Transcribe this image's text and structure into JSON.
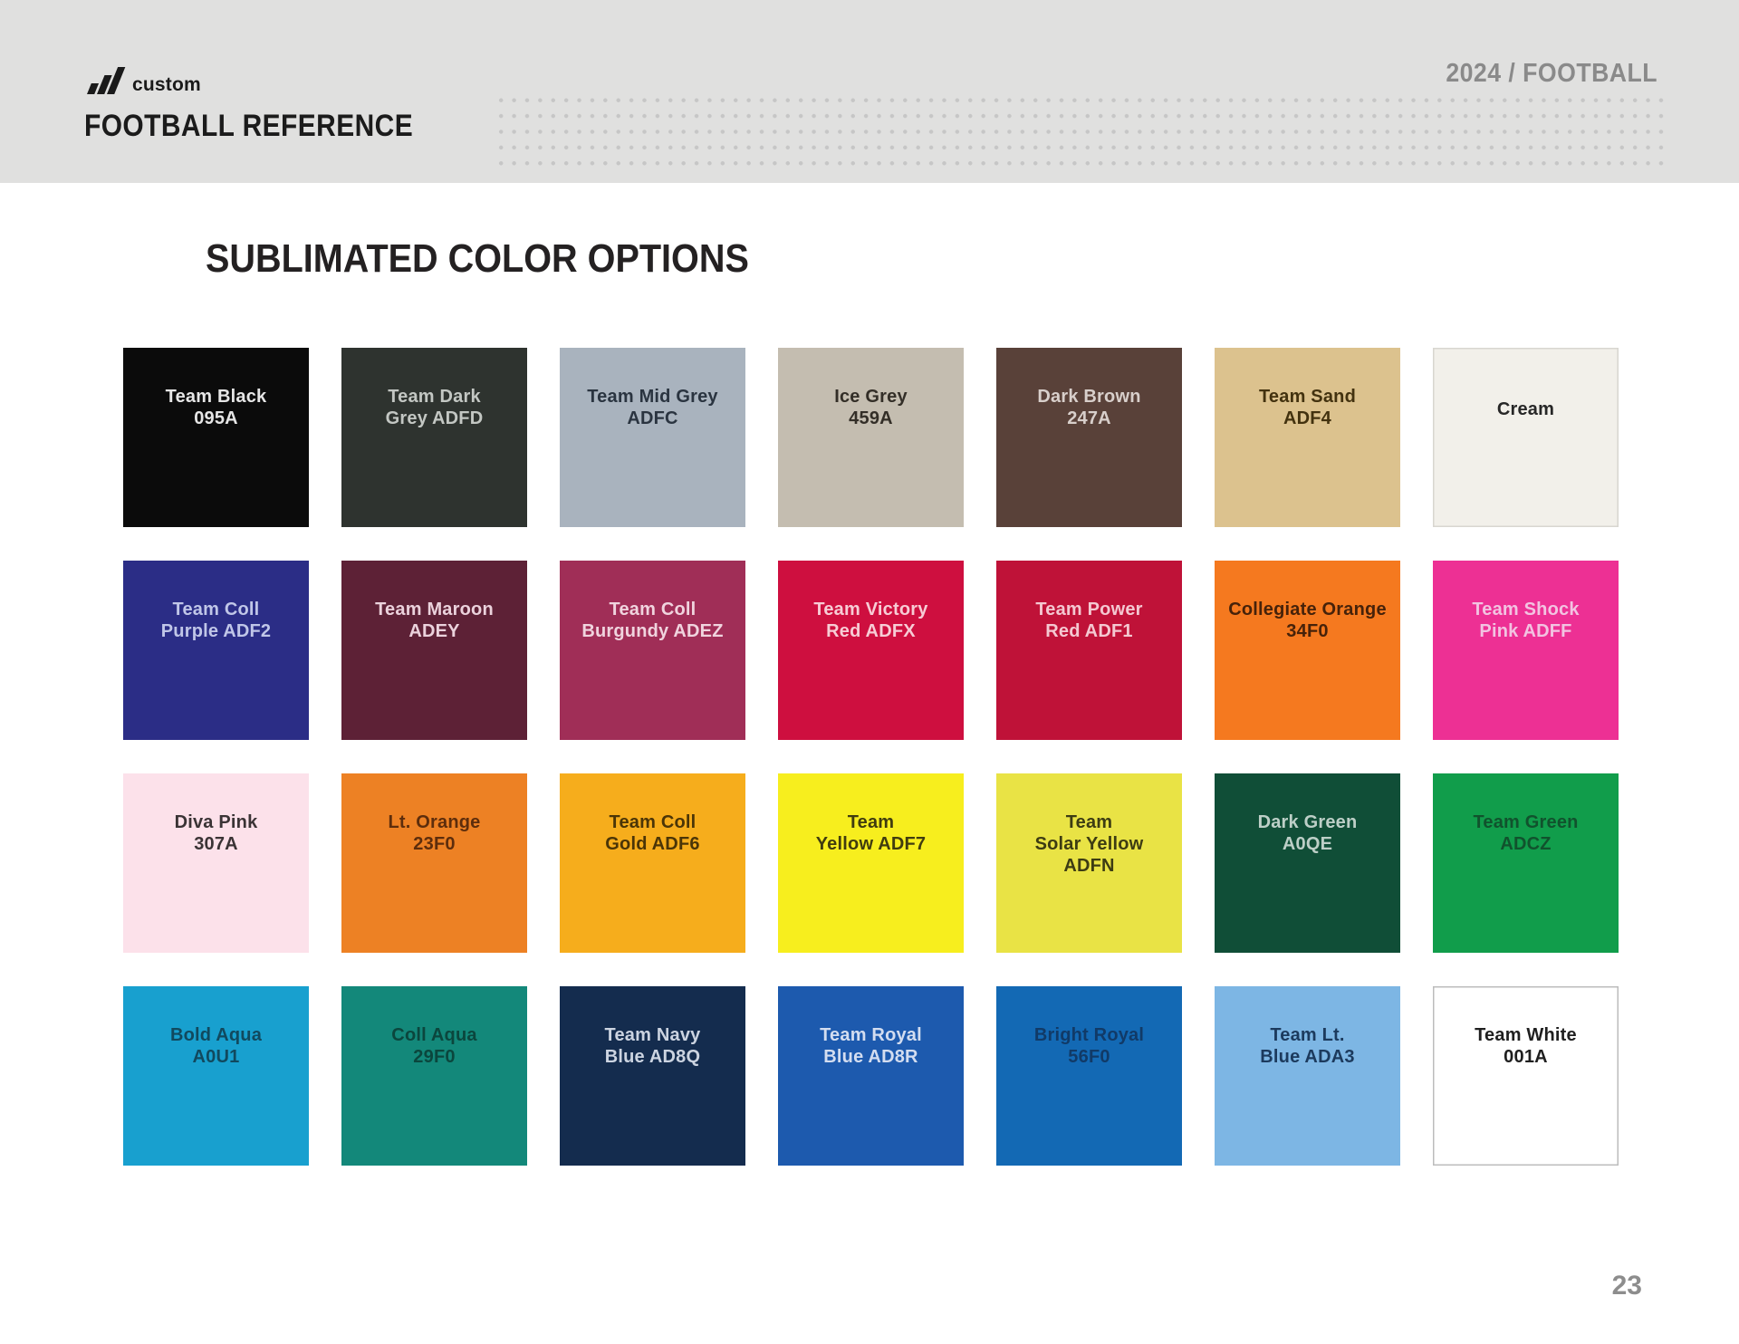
{
  "page": {
    "background": "#ffffff",
    "page_number": "23"
  },
  "header": {
    "background": "#e0e0df",
    "brand": "custom",
    "title": "FOOTBALL REFERENCE",
    "season_label": "2024 / FOOTBALL",
    "dot_color": "#c6c6c6"
  },
  "main": {
    "heading": "SUBLIMATED COLOR OPTIONS"
  },
  "swatches": [
    {
      "label": "Team Black\n095A",
      "bg": "#0b0b0b",
      "fg": "#e6e6e6",
      "border": ""
    },
    {
      "label": "Team Dark\nGrey ADFD",
      "bg": "#2e332f",
      "fg": "#c3c7c3",
      "border": ""
    },
    {
      "label": "Team Mid Grey\nADFC",
      "bg": "#a9b3be",
      "fg": "#2a3440",
      "border": ""
    },
    {
      "label": "Ice Grey\n459A",
      "bg": "#c4bdb0",
      "fg": "#332e27",
      "border": ""
    },
    {
      "label": "Dark Brown\n247A",
      "bg": "#594139",
      "fg": "#d8cfcb",
      "border": ""
    },
    {
      "label": "Team Sand\nADF4",
      "bg": "#dcc28e",
      "fg": "#43320f",
      "border": ""
    },
    {
      "label": "Cream",
      "bg": "#f2f0ea",
      "fg": "#272727",
      "border": "#d8d6d0"
    },
    {
      "label": "Team Coll\nPurple ADF2",
      "bg": "#2b2d86",
      "fg": "#c0c6e8",
      "border": ""
    },
    {
      "label": "Team Maroon\nADEY",
      "bg": "#5d2136",
      "fg": "#ebd2dc",
      "border": ""
    },
    {
      "label": "Team Coll\nBurgundy ADEZ",
      "bg": "#a02e57",
      "fg": "#f0d4de",
      "border": ""
    },
    {
      "label": "Team Victory\nRed ADFX",
      "bg": "#ce0f3f",
      "fg": "#f7ccd5",
      "border": ""
    },
    {
      "label": "Team Power\nRed ADF1",
      "bg": "#bf1238",
      "fg": "#f4c8d1",
      "border": ""
    },
    {
      "label": "Collegiate Orange\n34F0",
      "bg": "#f5791f",
      "fg": "#46220a",
      "border": ""
    },
    {
      "label": "Team Shock\nPink ADFF",
      "bg": "#ed3094",
      "fg": "#f2c3e1",
      "border": ""
    },
    {
      "label": "Diva Pink\n307A",
      "bg": "#fce1ea",
      "fg": "#3a3335",
      "border": ""
    },
    {
      "label": "Lt. Orange\n23F0",
      "bg": "#ed8124",
      "fg": "#5d2d0c",
      "border": ""
    },
    {
      "label": "Team Coll\nGold ADF6",
      "bg": "#f6ad1c",
      "fg": "#4b3507",
      "border": ""
    },
    {
      "label": "Team\nYellow ADF7",
      "bg": "#f7ee1e",
      "fg": "#403c0f",
      "border": ""
    },
    {
      "label": "Team\nSolar Yellow\nADFN",
      "bg": "#e9e345",
      "fg": "#3d3c13",
      "border": ""
    },
    {
      "label": "Dark Green\nA0QE",
      "bg": "#104e37",
      "fg": "#bdcfc7",
      "border": ""
    },
    {
      "label": "Team Green\nADCZ",
      "bg": "#119d4b",
      "fg": "#11522d",
      "border": ""
    },
    {
      "label": "Bold Aqua\nA0U1",
      "bg": "#18a0cf",
      "fg": "#11495e",
      "border": ""
    },
    {
      "label": "Coll Aqua\n29F0",
      "bg": "#13887a",
      "fg": "#0b463d",
      "border": ""
    },
    {
      "label": "Team Navy\nBlue AD8Q",
      "bg": "#142c4e",
      "fg": "#ccd4e1",
      "border": ""
    },
    {
      "label": "Team Royal\nBlue AD8R",
      "bg": "#1d5aae",
      "fg": "#d3ddf0",
      "border": ""
    },
    {
      "label": "Bright Royal\n56F0",
      "bg": "#1369b4",
      "fg": "#113a67",
      "border": ""
    },
    {
      "label": "Team Lt.\nBlue ADA3",
      "bg": "#7db6e4",
      "fg": "#1c3a5d",
      "border": ""
    },
    {
      "label": "Team White\n001A",
      "bg": "#ffffff",
      "fg": "#1f1f1f",
      "border": "#bcbcbc"
    }
  ]
}
